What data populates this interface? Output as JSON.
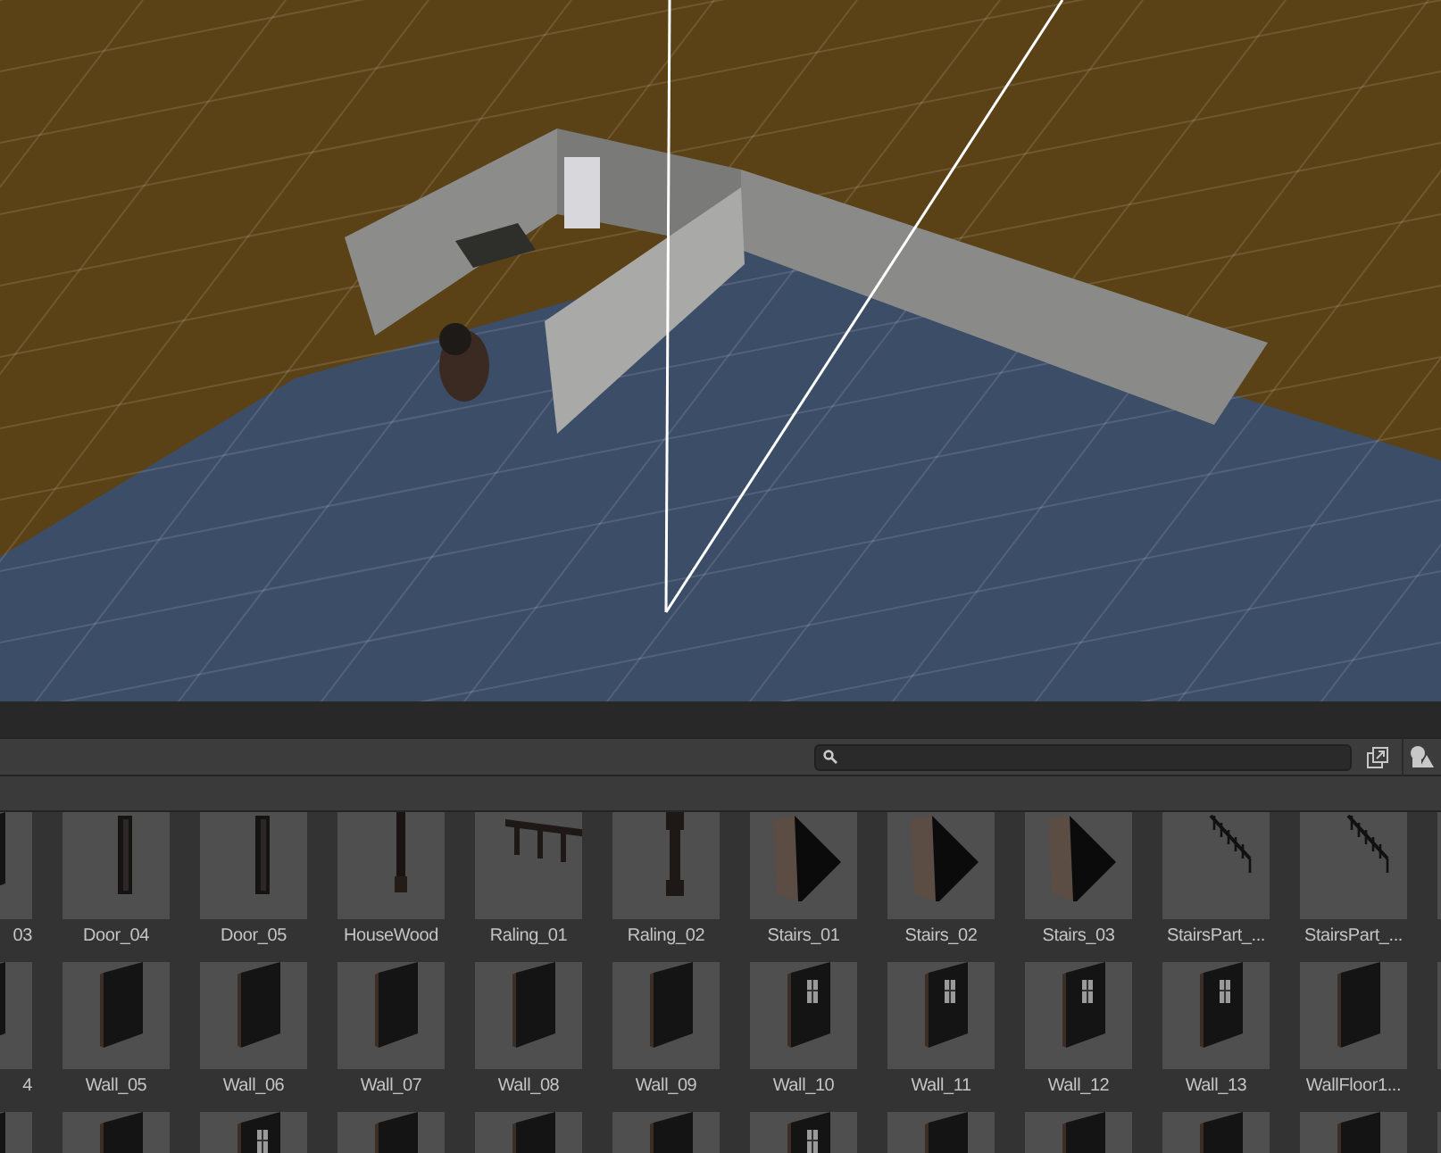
{
  "project_browser": {
    "rows": [
      [
        {
          "label": "03",
          "kind": "partial"
        },
        {
          "label": "Door_04",
          "kind": "door"
        },
        {
          "label": "Door_05",
          "kind": "door"
        },
        {
          "label": "HouseWood",
          "kind": "post"
        },
        {
          "label": "Raling_01",
          "kind": "railing"
        },
        {
          "label": "Raling_02",
          "kind": "pillar"
        },
        {
          "label": "Stairs_01",
          "kind": "stairs"
        },
        {
          "label": "Stairs_02",
          "kind": "stairs"
        },
        {
          "label": "Stairs_03",
          "kind": "stairs"
        },
        {
          "label": "StairsPart_...",
          "kind": "stairs_part"
        },
        {
          "label": "StairsPart_...",
          "kind": "stairs_part"
        },
        {
          "kind": "partial"
        }
      ],
      [
        {
          "label": "4",
          "kind": "partial"
        },
        {
          "label": "Wall_05",
          "kind": "wall"
        },
        {
          "label": "Wall_06",
          "kind": "wall"
        },
        {
          "label": "Wall_07",
          "kind": "wall"
        },
        {
          "label": "Wall_08",
          "kind": "wall"
        },
        {
          "label": "Wall_09",
          "kind": "wall"
        },
        {
          "label": "Wall_10",
          "kind": "wall_window"
        },
        {
          "label": "Wall_11",
          "kind": "wall_window"
        },
        {
          "label": "Wall_12",
          "kind": "wall_window"
        },
        {
          "label": "Wall_13",
          "kind": "wall_window"
        },
        {
          "label": "WallFloor1...",
          "kind": "wall"
        },
        {
          "kind": "partial"
        }
      ],
      [
        {
          "kind": "partial"
        },
        {
          "kind": "wall"
        },
        {
          "kind": "wall_window"
        },
        {
          "kind": "wall"
        },
        {
          "kind": "wall"
        },
        {
          "kind": "wall"
        },
        {
          "kind": "wall_window"
        },
        {
          "kind": "wall"
        },
        {
          "kind": "wall"
        },
        {
          "kind": "wall"
        },
        {
          "kind": "wall"
        },
        {
          "kind": "partial"
        }
      ]
    ]
  }
}
